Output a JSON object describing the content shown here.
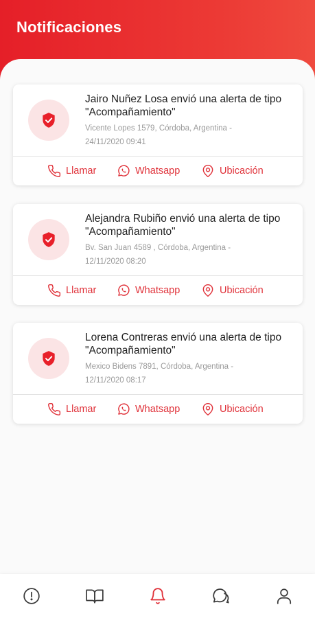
{
  "header": {
    "title": "Notificaciones"
  },
  "notifications": [
    {
      "message": "Jairo Nuñez Losa  envió una alerta de tipo \"Acompañamiento\"",
      "address": "Vicente Lopes 1579, Córdoba, Argentina - 24/11/2020 09:41"
    },
    {
      "message": "Alejandra Rubiño  envió una alerta de tipo \"Acompañamiento\"",
      "address": "Bv. San Juan 4589 , Córdoba, Argentina - 12/11/2020 08:20"
    },
    {
      "message": "Lorena Contreras  envió una alerta de tipo \"Acompañamiento\"",
      "address": "Mexico Bidens 7891, Córdoba, Argentina - 12/11/2020 08:17"
    }
  ],
  "actions": {
    "call_label": "Llamar",
    "whatsapp_label": "Whatsapp",
    "location_label": "Ubicación"
  },
  "icons": {
    "alert": "shield-check-icon",
    "call": "phone-icon",
    "whatsapp": "whatsapp-icon",
    "location": "map-pin-icon"
  },
  "bottom_nav": [
    {
      "icon": "alert-circle-icon",
      "active": false
    },
    {
      "icon": "book-open-icon",
      "active": false
    },
    {
      "icon": "bell-icon",
      "active": true
    },
    {
      "icon": "chat-icon",
      "active": false
    },
    {
      "icon": "user-icon",
      "active": false
    }
  ],
  "colors": {
    "accent": "#e0323a",
    "header": "#e8282f",
    "icon_bg": "#fbe4e5",
    "nav_inactive": "#3a3a3a"
  }
}
